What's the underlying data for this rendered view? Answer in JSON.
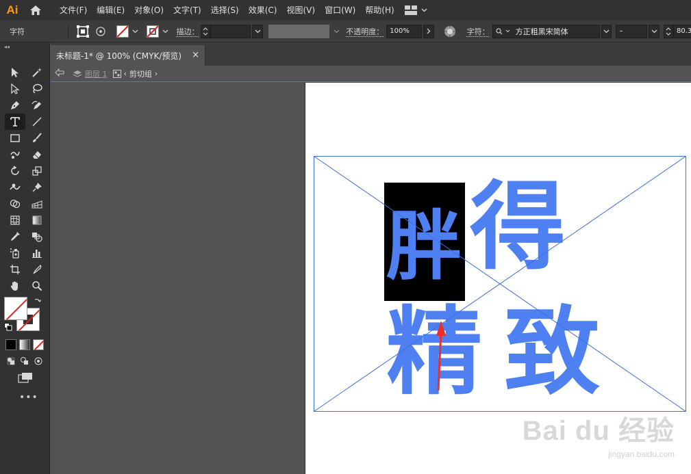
{
  "app": {
    "logo": "Ai"
  },
  "menu": {
    "items": [
      "文件(F)",
      "编辑(E)",
      "对象(O)",
      "文字(T)",
      "选择(S)",
      "效果(C)",
      "视图(V)",
      "窗口(W)",
      "帮助(H)"
    ]
  },
  "control": {
    "panel_label": "字符",
    "stroke_label": "描边：",
    "opacity_label": "不透明度：",
    "opacity_value": "100%",
    "char_label": "字符：",
    "font_name": "方正粗黑宋简体",
    "font_style": "–",
    "font_size": "80.3"
  },
  "document": {
    "tab_title": "未标题-1* @ 100% (CMYK/预览)",
    "tab_close": "×"
  },
  "breadcrumb": {
    "layer": "图层 1",
    "group": "剪切组"
  },
  "artwork": {
    "selected_char": "胖",
    "char_2": "得",
    "char_3": "精",
    "char_4": "致",
    "text_color": "#4f80f2"
  },
  "watermark": {
    "logo": "Bai du 经验",
    "url": "jingyan.baidu.com"
  },
  "toolbar": {
    "more": "•••"
  }
}
